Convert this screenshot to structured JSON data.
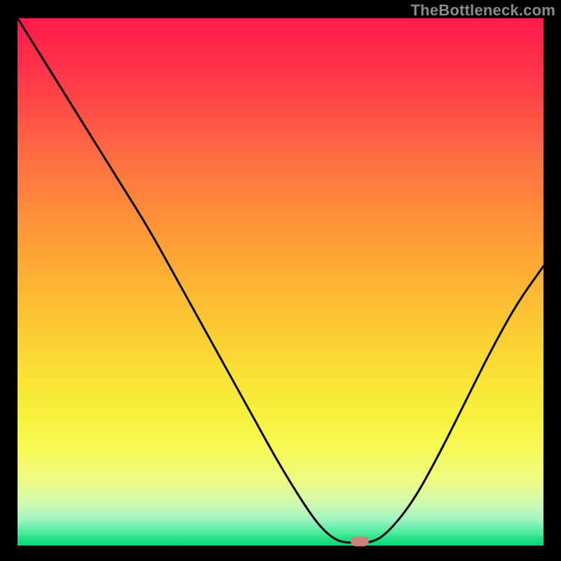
{
  "watermark": "TheBottleneck.com",
  "marker": {
    "x_pct": 65.0,
    "y_pct": 99.2
  },
  "chart_data": {
    "type": "line",
    "title": "",
    "xlabel": "",
    "ylabel": "",
    "xlim": [
      0,
      100
    ],
    "ylim": [
      0,
      100
    ],
    "grid": false,
    "series": [
      {
        "name": "curve",
        "x": [
          0.0,
          5.0,
          10.0,
          15.0,
          20.0,
          25.0,
          30.0,
          35.0,
          40.0,
          45.0,
          50.0,
          55.0,
          58.0,
          61.0,
          64.0,
          67.0,
          70.0,
          75.0,
          80.0,
          85.0,
          90.0,
          95.0,
          100.0
        ],
        "y": [
          100.0,
          92.0,
          84.0,
          76.0,
          68.0,
          60.0,
          51.0,
          42.0,
          33.0,
          24.0,
          15.0,
          7.0,
          3.0,
          0.7,
          0.5,
          0.5,
          2.0,
          8.0,
          17.0,
          27.0,
          37.0,
          46.0,
          53.0
        ]
      }
    ],
    "background_gradient": {
      "top": "#ff1a4b",
      "mid": "#fbd633",
      "bottom": "#0cd878"
    },
    "marker_point": {
      "x": 65.0,
      "y": 0.8,
      "color": "#cf7e78"
    }
  }
}
